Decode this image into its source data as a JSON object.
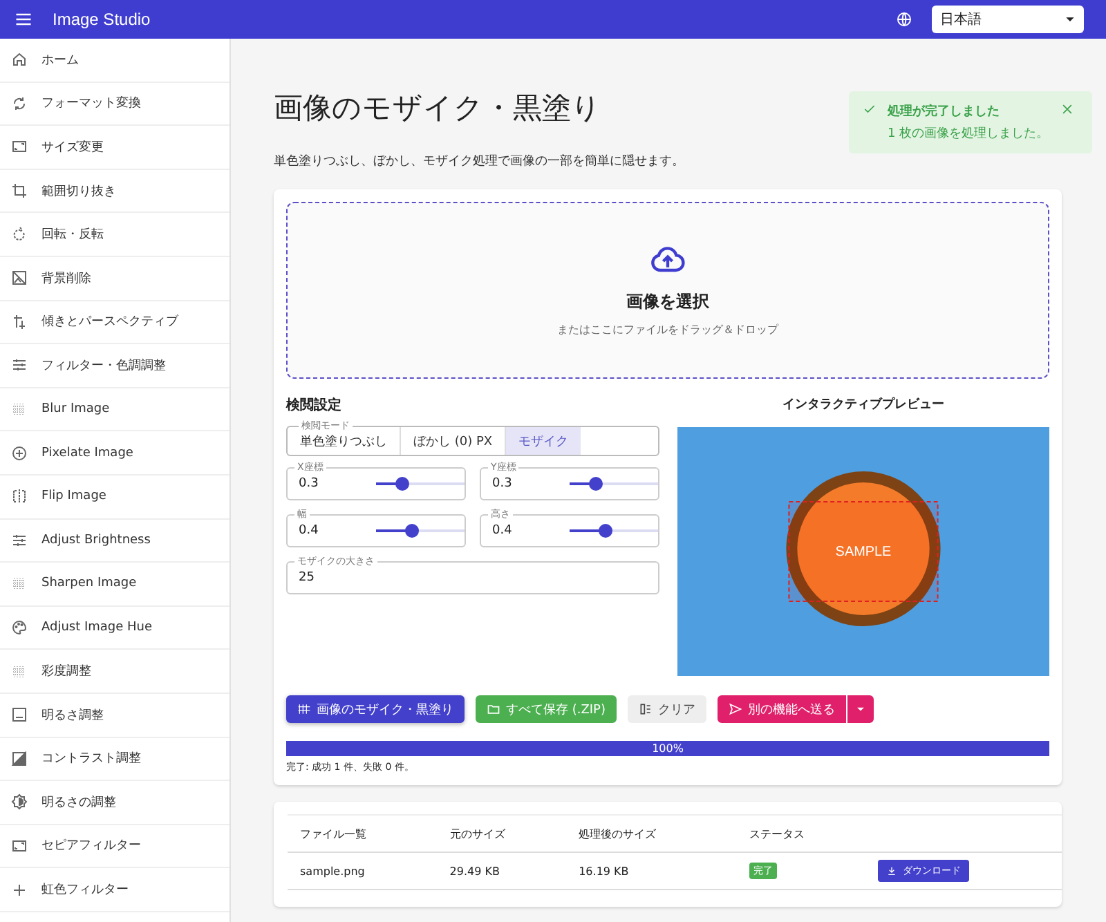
{
  "app_bar": {
    "title": "Image Studio",
    "language": "日本語"
  },
  "sidebar": {
    "items": [
      {
        "label": "ホーム"
      },
      {
        "label": "フォーマット変換"
      },
      {
        "label": "サイズ変更"
      },
      {
        "label": "範囲切り抜き"
      },
      {
        "label": "回転・反転"
      },
      {
        "label": "背景削除"
      },
      {
        "label": "傾きとパースペクティブ"
      },
      {
        "label": "フィルター・色調調整"
      },
      {
        "label": "Blur Image"
      },
      {
        "label": "Pixelate Image"
      },
      {
        "label": "Flip Image"
      },
      {
        "label": "Adjust Brightness"
      },
      {
        "label": "Sharpen Image"
      },
      {
        "label": "Adjust Image Hue"
      },
      {
        "label": "彩度調整"
      },
      {
        "label": "明るさ調整"
      },
      {
        "label": "コントラスト調整"
      },
      {
        "label": "明るさの調整"
      },
      {
        "label": "セピアフィルター"
      },
      {
        "label": "虹色フィルター"
      }
    ]
  },
  "page": {
    "title": "画像のモザイク・黒塗り",
    "description": "単色塗りつぶし、ぼかし、モザイク処理で画像の一部を簡単に隠せます。"
  },
  "toast": {
    "title": "処理が完了しました",
    "message": "1 枚の画像を処理しました。"
  },
  "dropzone": {
    "title": "画像を選択",
    "hint": "またはここにファイルをドラッグ＆ドロップ"
  },
  "settings": {
    "title": "検閲設定",
    "mode_label": "検閲モード",
    "modes": [
      {
        "label": "単色塗りつぶし",
        "selected": false
      },
      {
        "label": "ぼかし (0) PX",
        "selected": false
      },
      {
        "label": "モザイク",
        "selected": true
      }
    ],
    "sliders": [
      {
        "label": "X座標",
        "value": "0.3",
        "level": 0.3
      },
      {
        "label": "Y座標",
        "value": "0.3",
        "level": 0.3
      },
      {
        "label": "幅",
        "value": "0.4",
        "level": 0.4
      },
      {
        "label": "高さ",
        "value": "0.4",
        "level": 0.4
      }
    ],
    "size_field": {
      "label": "モザイクの大きさ",
      "value": "25"
    }
  },
  "preview": {
    "title": "インタラクティブプレビュー",
    "sample_text": "SAMPLE"
  },
  "actions": [
    {
      "label": "画像のモザイク・黒塗り",
      "kind": "primary"
    },
    {
      "label": "すべて保存 (.ZIP)",
      "kind": "save"
    },
    {
      "label": "クリア",
      "kind": "clear"
    },
    {
      "label": "別の機能へ送る",
      "kind": "send"
    }
  ],
  "progress": {
    "label": "100%",
    "level": 1,
    "status": "完了: 成功 1 件、失敗 0 件。"
  },
  "table": {
    "columns": [
      "ファイル一覧",
      "元のサイズ",
      "処理後のサイズ",
      "ステータス"
    ],
    "rows": [
      {
        "name": "sample.png",
        "original": "29.49 KB",
        "processed": "16.19 KB",
        "status": "完了",
        "action": "ダウンロード"
      }
    ]
  }
}
